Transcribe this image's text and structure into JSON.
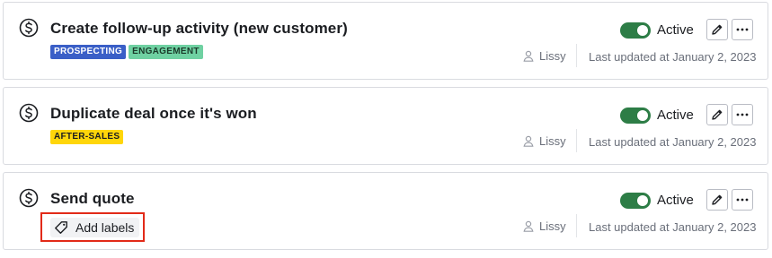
{
  "automations": [
    {
      "title": "Create follow-up activity (new customer)",
      "labels": [
        {
          "text": "PROSPECTING",
          "bg": "#3a5fc7",
          "color": "#ffffff"
        },
        {
          "text": "ENGAGEMENT",
          "bg": "#6fd1a2",
          "color": "#1b3a2a"
        }
      ],
      "status": "Active",
      "status_on": true,
      "owner": "Lissy",
      "updated": "Last updated at January 2, 2023"
    },
    {
      "title": "Duplicate deal once it's won",
      "labels": [
        {
          "text": "AFTER-SALES",
          "bg": "#ffd60a",
          "color": "#1b1d21"
        }
      ],
      "status": "Active",
      "status_on": true,
      "owner": "Lissy",
      "updated": "Last updated at January 2, 2023"
    },
    {
      "title": "Send quote",
      "labels": [],
      "add_labels": "Add labels",
      "status": "Active",
      "status_on": true,
      "owner": "Lissy",
      "updated": "Last updated at January 2, 2023"
    }
  ],
  "icons": {
    "item": "dollar-circle-icon",
    "edit": "pencil-icon",
    "more": "ellipsis-icon",
    "owner": "user-icon",
    "add_labels": "tag-icon"
  },
  "colors": {
    "toggle_on": "#2d7d46",
    "highlight": "#e22a18"
  }
}
